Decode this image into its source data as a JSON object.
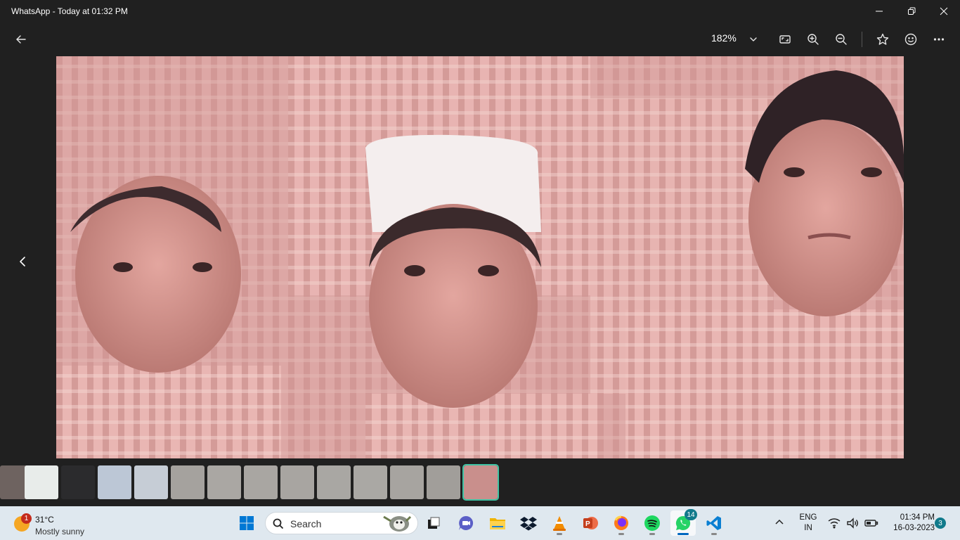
{
  "window": {
    "title": "WhatsApp - Today at 01:32 PM",
    "controls": [
      "minimize",
      "restore",
      "close"
    ]
  },
  "toolbar": {
    "zoom_level": "182%",
    "buttons": [
      "back-arrow-icon",
      "fit-to-window-icon",
      "zoom-in-icon",
      "zoom-out-icon",
      "favorite-star-icon",
      "emoji-icon",
      "more-options-icon"
    ]
  },
  "viewer": {
    "image_description_icon": "photo"
  },
  "filmstrip": {
    "count": 14,
    "active_index": 13
  },
  "taskbar": {
    "weather": {
      "badge": "1",
      "temp": "31°C",
      "desc": "Mostly sunny"
    },
    "search": {
      "placeholder": "Search"
    },
    "apps": [
      "windows-start",
      "search",
      "task-view",
      "teams-chat",
      "file-explorer",
      "dropbox",
      "vlc",
      "powerpoint",
      "firefox",
      "spotify",
      "whatsapp",
      "vscode"
    ],
    "whatsapp_badge": "14",
    "language": {
      "line1": "ENG",
      "line2": "IN"
    },
    "clock": {
      "time": "01:34 PM",
      "date": "16-03-2023"
    },
    "notification_count": "3"
  },
  "colors": {
    "background": "#202020",
    "taskbar": "#dfe8ef",
    "accent": "#3fc3a4"
  }
}
